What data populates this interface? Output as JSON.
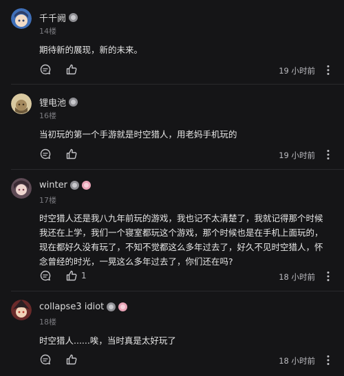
{
  "comments": [
    {
      "username": "千千阙",
      "floor": "14楼",
      "text": "期待新的展现，新的未来。",
      "likes": "",
      "time": "19 小时前",
      "avatar_color": "#5b8ed6"
    },
    {
      "username": "锂电池",
      "floor": "16楼",
      "text": "当初玩的第一个手游就是时空猎人，用老妈手机玩的",
      "likes": "",
      "time": "19 小时前",
      "avatar_color": "#c9b48a"
    },
    {
      "username": "winter",
      "floor": "17楼",
      "text": "时空猎人还是我八九年前玩的游戏，我也记不太清楚了，我就记得那个时候我还在上学，我们一个寝室都玩这个游戏，那个时候也是在手机上面玩的，现在都好久没有玩了，不知不觉都这么多年过去了，好久不见时空猎人，怀念曾经的时光，一晃这么多年过去了，你们还在吗?",
      "likes": "1",
      "time": "18 小时前",
      "avatar_color": "#8a6a7a"
    },
    {
      "username": "collapse3 idiot",
      "floor": "18楼",
      "text": "时空猎人......唉，当时真是太好玩了",
      "likes": "",
      "time": "18 小时前",
      "avatar_color": "#b0534a"
    }
  ],
  "icons": {
    "reply": "reply-bubble-icon",
    "like": "thumbs-up-icon",
    "more": "more-dots-icon",
    "badge": "level-badge-icon"
  },
  "colors": {
    "background": "#151517",
    "text": "#e6e6e6",
    "muted": "#7a7a7f",
    "divider": "#2a2a2d"
  }
}
